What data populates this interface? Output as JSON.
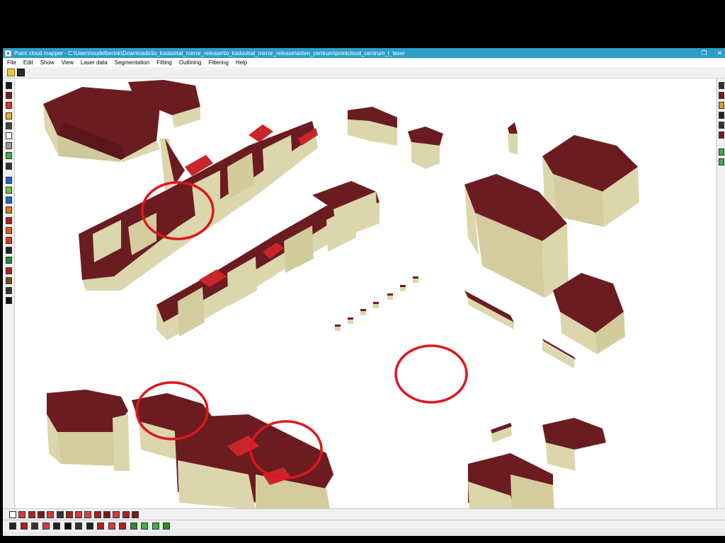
{
  "window": {
    "title": "Point cloud mapper - C:\\Users\\oudelberink\\Downloads\\to_kadastral_mirror_release\\to_kadastral_mirror_release\\asten_centrum\\pointcloud_centrum_t_laser",
    "controls": {
      "restore": "❐",
      "close": "✕"
    }
  },
  "menu": {
    "items": [
      "File",
      "Edit",
      "Show",
      "View",
      "Laser data",
      "Segmentation",
      "Fitting",
      "Outlining",
      "Filtering",
      "Help"
    ]
  },
  "toolbar": {
    "buttons": [
      "open-folder-icon",
      "save-disk-icon"
    ]
  },
  "left_tools": {
    "icons": [
      "select-icon",
      "dark-red-fill-icon",
      "red-yellow-icon",
      "yellow-fill-icon",
      "checker-icon",
      "white-fill-icon",
      "gray-fill-icon",
      "green-fill-icon",
      "dark-pattern-icon",
      "rotate-icon",
      "pencil-icon",
      "target-icon",
      "fire-icon",
      "gear-red-icon",
      "flame-icon",
      "plane-icon",
      "walk-icon",
      "shield-icon",
      "grid-red-icon",
      "brick-icon",
      "door-icon",
      "shape-icon"
    ]
  },
  "right_tools": {
    "icons": [
      "layer-icon-1",
      "layer-icon-2",
      "layer-icon-3",
      "layer-icon-4",
      "layer-icon-5",
      "layer-icon-6",
      "arrow-left-icon",
      "green-dot-icon"
    ]
  },
  "bottom_tools_1": {
    "icons": [
      "white-box-icon",
      "stripe-icon",
      "grid-icon-a",
      "grid-icon-b",
      "grid-icon-c",
      "grid-icon-d",
      "grid-icon-e",
      "grid-icon-f",
      "circle-icon",
      "grid-icon-g",
      "grid-icon-h",
      "grid-icon-i",
      "grid-icon-j",
      "grid-icon-k"
    ]
  },
  "bottom_tools_2": {
    "icons": [
      "star-icon",
      "x-icon",
      "z-icon",
      "flag-icon",
      "arrows-icon",
      "slash-icon",
      "frame-icon",
      "page-icon",
      "red-box-icon",
      "diamond-icon",
      "triangle-icon",
      "leaf-icon",
      "green-check-icon",
      "green-heart-icon",
      "green-square-icon"
    ]
  },
  "scene": {
    "roof_color": "#6b1c20",
    "wall_color": "#dcd6ad",
    "highlight_color": "#e0151e"
  }
}
